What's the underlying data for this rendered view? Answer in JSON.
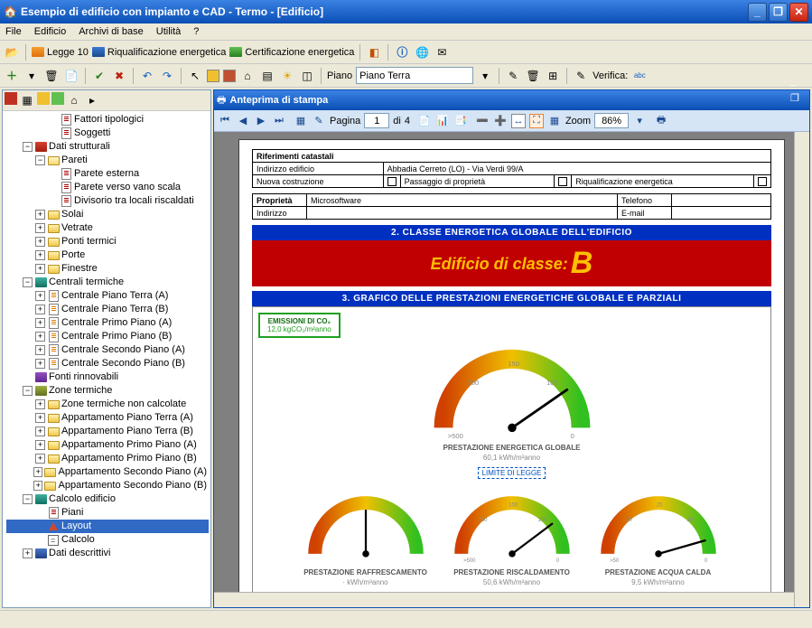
{
  "window": {
    "title": "Esempio di edificio con impianto e CAD - Termo - [Edificio]"
  },
  "menu": [
    "File",
    "Edificio",
    "Archivi di base",
    "Utilità",
    "?"
  ],
  "toolbar1": {
    "legge10": "Legge 10",
    "riqual": "Riqualificazione energetica",
    "cert": "Certificazione energetica"
  },
  "toolbar2": {
    "piano_label": "Piano",
    "piano_value": "Piano Terra",
    "verifica_label": "Verifica:"
  },
  "tree": [
    {
      "d": 3,
      "icon": "page",
      "label": "Fattori tipologici"
    },
    {
      "d": 3,
      "icon": "page",
      "label": "Soggetti"
    },
    {
      "d": 1,
      "exp": "-",
      "icon": "book-red",
      "label": "Dati strutturali"
    },
    {
      "d": 2,
      "exp": "-",
      "icon": "folder-open",
      "label": "Pareti"
    },
    {
      "d": 3,
      "icon": "page",
      "label": "Parete esterna"
    },
    {
      "d": 3,
      "icon": "page",
      "label": "Parete verso vano scala"
    },
    {
      "d": 3,
      "icon": "page",
      "label": "Divisorio tra locali riscaldati"
    },
    {
      "d": 2,
      "exp": "+",
      "icon": "folder",
      "label": "Solai"
    },
    {
      "d": 2,
      "exp": "+",
      "icon": "folder",
      "label": "Vetrate"
    },
    {
      "d": 2,
      "exp": "+",
      "icon": "folder",
      "label": "Ponti termici"
    },
    {
      "d": 2,
      "exp": "+",
      "icon": "folder",
      "label": "Porte"
    },
    {
      "d": 2,
      "exp": "+",
      "icon": "folder",
      "label": "Finestre"
    },
    {
      "d": 1,
      "exp": "-",
      "icon": "book-teal",
      "label": "Centrali termiche"
    },
    {
      "d": 2,
      "exp": "+",
      "icon": "page-orange",
      "label": "Centrale Piano Terra (A)"
    },
    {
      "d": 2,
      "exp": "+",
      "icon": "page-orange",
      "label": "Centrale Piano Terra (B)"
    },
    {
      "d": 2,
      "exp": "+",
      "icon": "page-orange",
      "label": "Centrale Primo Piano (A)"
    },
    {
      "d": 2,
      "exp": "+",
      "icon": "page-orange",
      "label": "Centrale Primo Piano (B)"
    },
    {
      "d": 2,
      "exp": "+",
      "icon": "page-orange",
      "label": "Centrale Secondo Piano (A)"
    },
    {
      "d": 2,
      "exp": "+",
      "icon": "page-orange",
      "label": "Centrale Secondo Piano (B)"
    },
    {
      "d": 1,
      "icon": "book-purple",
      "label": "Fonti rinnovabili"
    },
    {
      "d": 1,
      "exp": "-",
      "icon": "book-olive",
      "label": "Zone termiche"
    },
    {
      "d": 2,
      "exp": "+",
      "icon": "folder",
      "label": "Zone termiche non calcolate"
    },
    {
      "d": 2,
      "exp": "+",
      "icon": "folder",
      "label": "Appartamento Piano Terra (A)"
    },
    {
      "d": 2,
      "exp": "+",
      "icon": "folder",
      "label": "Appartamento Piano Terra (B)"
    },
    {
      "d": 2,
      "exp": "+",
      "icon": "folder",
      "label": "Appartamento Primo Piano (A)"
    },
    {
      "d": 2,
      "exp": "+",
      "icon": "folder",
      "label": "Appartamento Primo Piano (B)"
    },
    {
      "d": 2,
      "exp": "+",
      "icon": "folder",
      "label": "Appartamento Secondo Piano (A)"
    },
    {
      "d": 2,
      "exp": "+",
      "icon": "folder",
      "label": "Appartamento Secondo Piano (B)"
    },
    {
      "d": 1,
      "exp": "-",
      "icon": "book-teal",
      "label": "Calcolo edificio"
    },
    {
      "d": 2,
      "icon": "page",
      "label": "Piani"
    },
    {
      "d": 2,
      "icon": "triangle",
      "label": "Layout",
      "selected": true
    },
    {
      "d": 2,
      "icon": "calc",
      "label": "Calcolo"
    },
    {
      "d": 1,
      "exp": "+",
      "icon": "book-blue",
      "label": "Dati descrittivi"
    }
  ],
  "preview": {
    "title": "Anteprima di stampa",
    "page_label": "Pagina",
    "page_current": "1",
    "page_sep": "di",
    "page_total": "4",
    "zoom_label": "Zoom",
    "zoom_value": "86%"
  },
  "doc": {
    "rif": "Riferimenti catastali",
    "ind_edif_l": "Indirizzo edificio",
    "ind_edif_v": "Abbadia Cerreto (LO) - Via Verdi 99/A",
    "nuova": "Nuova costruzione",
    "passaggio": "Passaggio di proprietà",
    "riqual": "Riqualificazione energetica",
    "proprieta_l": "Proprietà",
    "proprieta_v": "Microsoftware",
    "telefono_l": "Telefono",
    "indirizzo_l": "Indirizzo",
    "email_l": "E-mail",
    "section2": "2. CLASSE ENERGETICA GLOBALE DELL'EDIFICIO",
    "class_text": "Edificio di classe:",
    "class_letter": "B",
    "section3": "3. GRAFICO DELLE PRESTAZIONI ENERGETICHE GLOBALE E PARZIALI",
    "emiss_t": "EMISSIONI DI CO₂",
    "emiss_v": "12,0 kgCO₂/m²anno",
    "limite": "LIMITE DI LEGGE",
    "g_global_t": "PRESTAZIONE ENERGETICA GLOBALE",
    "g_global_v": "60,1 kWh/m²anno",
    "g_raffr_t": "PRESTAZIONE RAFFRESCAMENTO",
    "g_raffr_v": "· kWh/m³anno",
    "g_risc_t": "PRESTAZIONE RISCALDAMENTO",
    "g_risc_v": "50,6 kWh/m²anno",
    "g_acqua_t": "PRESTAZIONE ACQUA CALDA",
    "g_acqua_v": "9,5 kWh/m²anno"
  },
  "chart_data": [
    {
      "type": "gauge",
      "title": "PRESTAZIONE ENERGETICA GLOBALE",
      "value": 60.1,
      "unit": "kWh/m²anno",
      "min": 0,
      "max": 500,
      "ticks": [
        0,
        100,
        150,
        200,
        500
      ],
      "needle_angle": 110
    },
    {
      "type": "gauge",
      "title": "PRESTAZIONE RAFFRESCAMENTO",
      "value": null,
      "unit": "kWh/m³anno",
      "min": 0,
      "max": null,
      "needle_angle": 90
    },
    {
      "type": "gauge",
      "title": "PRESTAZIONE RISCALDAMENTO",
      "value": 50.6,
      "unit": "kWh/m²anno",
      "min": 0,
      "max": 500,
      "ticks": [
        0,
        100,
        150,
        200,
        500
      ],
      "needle_angle": 115
    },
    {
      "type": "gauge",
      "title": "PRESTAZIONE ACQUA CALDA",
      "value": 9.5,
      "unit": "kWh/m²anno",
      "min": 0,
      "max": 50,
      "ticks": [
        0,
        10,
        25,
        30,
        50
      ],
      "needle_angle": 145
    }
  ]
}
